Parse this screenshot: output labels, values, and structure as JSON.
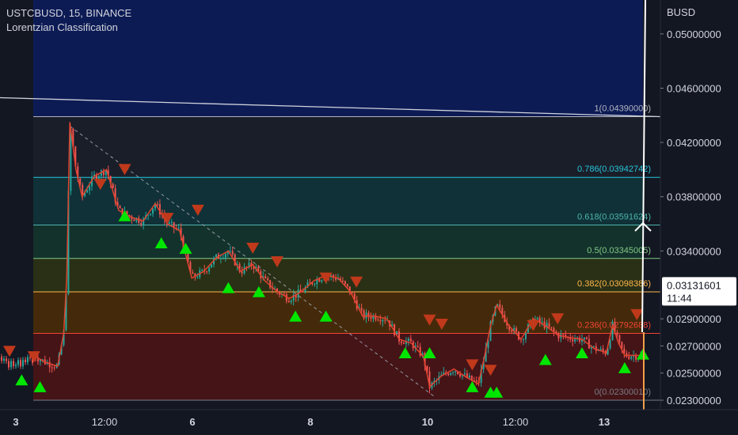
{
  "header": {
    "symbol_line": "USTCBUSD, 15, BINANCE",
    "indicator": "Lorentzian Classification"
  },
  "price_scale": {
    "currency": "BUSD",
    "labels": [
      "0.05000000",
      "0.04600000",
      "0.04200000",
      "0.03800000",
      "0.03400000",
      "0.02900000",
      "0.02700000",
      "0.02500000",
      "0.02300000"
    ],
    "last_price": "0.03131601",
    "countdown": "11:44"
  },
  "time_scale": {
    "labels": [
      "3",
      "12:00",
      "6",
      "8",
      "10",
      "12:00",
      "13"
    ]
  },
  "colors": {
    "background": "#131722",
    "bull": "#26a69a",
    "bear": "#ef5350",
    "buy_signal": "#00e600",
    "sell_signal": "#c0391b",
    "fib_top_zone": "#0d1b55"
  },
  "chart_data": {
    "type": "candlestick",
    "y_range": [
      0.0223,
      0.0525
    ],
    "fib_levels": [
      {
        "ratio": "1",
        "label": "1(0.04390000)",
        "price": 0.0439,
        "color": "#b2b5be",
        "fill": "#1c1f2a"
      },
      {
        "ratio": "0.786",
        "label": "0.786(0.03942742)",
        "price": 0.03942742,
        "color": "#26c6da",
        "fill": "#10343a"
      },
      {
        "ratio": "0.618",
        "label": "0.618(0.03591624)",
        "price": 0.03591624,
        "color": "#4db6ac",
        "fill": "#14352e"
      },
      {
        "ratio": "0.5",
        "label": "0.5(0.03345005)",
        "price": 0.03345005,
        "color": "#81c784",
        "fill": "#2e3314"
      },
      {
        "ratio": "0.382",
        "label": "0.382(0.03098386)",
        "price": 0.03098386,
        "color": "#ffb74d",
        "fill": "#4a2c08"
      },
      {
        "ratio": "0.236",
        "label": "0.236(0.02792688)",
        "price": 0.02792688,
        "color": "#f44336",
        "fill": "#4a1416"
      },
      {
        "ratio": "0",
        "label": "0(0.02300010)",
        "price": 0.0230001,
        "color": "#787b86",
        "fill": ""
      }
    ],
    "price_path": [
      [
        0.0,
        0.0263
      ],
      [
        0.02,
        0.0258
      ],
      [
        0.04,
        0.0255
      ],
      [
        0.05,
        0.028
      ],
      [
        0.055,
        0.032
      ],
      [
        0.06,
        0.0435
      ],
      [
        0.07,
        0.04
      ],
      [
        0.08,
        0.038
      ],
      [
        0.1,
        0.0395
      ],
      [
        0.12,
        0.04
      ],
      [
        0.14,
        0.037
      ],
      [
        0.16,
        0.0365
      ],
      [
        0.18,
        0.0362
      ],
      [
        0.2,
        0.0375
      ],
      [
        0.22,
        0.036
      ],
      [
        0.24,
        0.0355
      ],
      [
        0.26,
        0.032
      ],
      [
        0.28,
        0.0325
      ],
      [
        0.3,
        0.0335
      ],
      [
        0.32,
        0.034
      ],
      [
        0.34,
        0.0325
      ],
      [
        0.36,
        0.033
      ],
      [
        0.38,
        0.0318
      ],
      [
        0.4,
        0.031
      ],
      [
        0.42,
        0.0305
      ],
      [
        0.44,
        0.031
      ],
      [
        0.46,
        0.0318
      ],
      [
        0.48,
        0.0322
      ],
      [
        0.5,
        0.032
      ],
      [
        0.52,
        0.031
      ],
      [
        0.54,
        0.0292
      ],
      [
        0.56,
        0.0292
      ],
      [
        0.58,
        0.029
      ],
      [
        0.6,
        0.0275
      ],
      [
        0.62,
        0.0272
      ],
      [
        0.64,
        0.0262
      ],
      [
        0.65,
        0.024
      ],
      [
        0.67,
        0.0248
      ],
      [
        0.69,
        0.0253
      ],
      [
        0.71,
        0.0247
      ],
      [
        0.73,
        0.0242
      ],
      [
        0.74,
        0.0262
      ],
      [
        0.75,
        0.0285
      ],
      [
        0.76,
        0.03
      ],
      [
        0.78,
        0.0285
      ],
      [
        0.8,
        0.0275
      ],
      [
        0.82,
        0.029
      ],
      [
        0.84,
        0.0285
      ],
      [
        0.86,
        0.0278
      ],
      [
        0.88,
        0.0276
      ],
      [
        0.9,
        0.0275
      ],
      [
        0.92,
        0.0268
      ],
      [
        0.94,
        0.0265
      ],
      [
        0.95,
        0.0285
      ],
      [
        0.96,
        0.0272
      ],
      [
        0.97,
        0.0263
      ]
    ],
    "trendline": {
      "start": [
        0.0,
        0.0453
      ],
      "end": [
        1.0,
        0.0439
      ]
    },
    "diagonal": {
      "start": [
        0.06,
        0.0432
      ],
      "end": [
        0.66,
        0.0232
      ]
    },
    "buy_signals": [
      [
        0.02,
        0.0245
      ],
      [
        0.05,
        0.024
      ],
      [
        0.15,
        0.0366
      ],
      [
        0.21,
        0.0346
      ],
      [
        0.25,
        0.0342
      ],
      [
        0.32,
        0.0313
      ],
      [
        0.37,
        0.031
      ],
      [
        0.43,
        0.0292
      ],
      [
        0.48,
        0.0292
      ],
      [
        0.61,
        0.0265
      ],
      [
        0.65,
        0.0265
      ],
      [
        0.72,
        0.024
      ],
      [
        0.75,
        0.0236
      ],
      [
        0.76,
        0.0236
      ],
      [
        0.84,
        0.026
      ],
      [
        0.9,
        0.0265
      ],
      [
        0.97,
        0.0254
      ],
      [
        1.0,
        0.0264
      ]
    ],
    "sell_signals": [
      [
        0.0,
        0.0266
      ],
      [
        0.04,
        0.0262
      ],
      [
        0.11,
        0.0389
      ],
      [
        0.15,
        0.04
      ],
      [
        0.22,
        0.0364
      ],
      [
        0.27,
        0.037
      ],
      [
        0.36,
        0.0342
      ],
      [
        0.4,
        0.0332
      ],
      [
        0.48,
        0.032
      ],
      [
        0.53,
        0.0317
      ],
      [
        0.65,
        0.0289
      ],
      [
        0.67,
        0.0286
      ],
      [
        0.72,
        0.0256
      ],
      [
        0.75,
        0.0252
      ],
      [
        0.82,
        0.0285
      ],
      [
        0.86,
        0.029
      ],
      [
        0.99,
        0.0293
      ]
    ]
  }
}
